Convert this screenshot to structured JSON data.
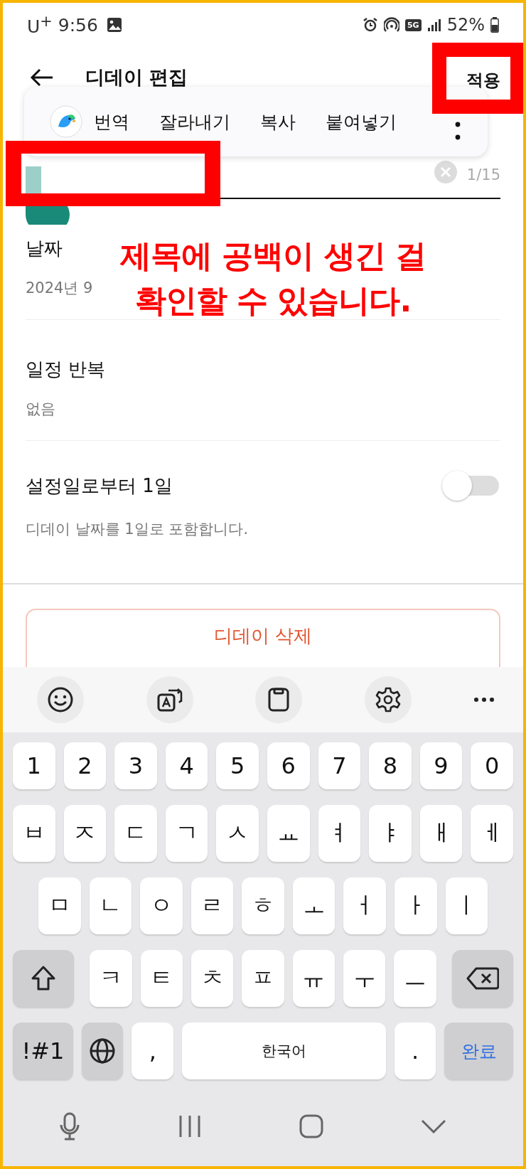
{
  "status_bar": {
    "carrier": "U$^{+}$",
    "time": "9:56",
    "network": "5G",
    "battery": "52%"
  },
  "header": {
    "title": "디데이 편집",
    "action": "적용"
  },
  "text_menu": {
    "items": [
      "번역",
      "잘라내기",
      "복사",
      "붙여넣기"
    ]
  },
  "title_field": {
    "counter": "1/15"
  },
  "sections": [
    {
      "kind": "value",
      "label": "날짜",
      "value": "2024년 9"
    },
    {
      "kind": "value",
      "label": "일정 반복",
      "value": "없음"
    },
    {
      "kind": "toggle",
      "label": "설정일로부터 1일",
      "description": "디데이 날짜를 1일로 포함합니다.",
      "on": false
    }
  ],
  "delete_button": "디데이 삭제",
  "keyboard": {
    "rows": [
      {
        "keys": [
          {
            "kind": "char",
            "label": "1"
          },
          {
            "kind": "char",
            "label": "2"
          },
          {
            "kind": "char",
            "label": "3"
          },
          {
            "kind": "char",
            "label": "4"
          },
          {
            "kind": "char",
            "label": "5"
          },
          {
            "kind": "char",
            "label": "6"
          },
          {
            "kind": "char",
            "label": "7"
          },
          {
            "kind": "char",
            "label": "8"
          },
          {
            "kind": "char",
            "label": "9"
          },
          {
            "kind": "char",
            "label": "0"
          }
        ]
      },
      {
        "keys": [
          {
            "kind": "char",
            "label": "ㅂ"
          },
          {
            "kind": "char",
            "label": "ㅈ"
          },
          {
            "kind": "char",
            "label": "ㄷ"
          },
          {
            "kind": "char",
            "label": "ㄱ"
          },
          {
            "kind": "char",
            "label": "ㅅ"
          },
          {
            "kind": "char",
            "label": "ㅛ"
          },
          {
            "kind": "char",
            "label": "ㅕ"
          },
          {
            "kind": "char",
            "label": "ㅑ"
          },
          {
            "kind": "char",
            "label": "ㅐ"
          },
          {
            "kind": "char",
            "label": "ㅔ"
          }
        ]
      },
      {
        "keys": [
          {
            "kind": "char",
            "label": "ㅁ"
          },
          {
            "kind": "char",
            "label": "ㄴ"
          },
          {
            "kind": "char",
            "label": "ㅇ"
          },
          {
            "kind": "char",
            "label": "ㄹ"
          },
          {
            "kind": "char",
            "label": "ㅎ"
          },
          {
            "kind": "char",
            "label": "ㅗ"
          },
          {
            "kind": "char",
            "label": "ㅓ"
          },
          {
            "kind": "char",
            "label": "ㅏ"
          },
          {
            "kind": "char",
            "label": "ㅣ"
          }
        ]
      },
      {
        "keys": [
          {
            "kind": "shift"
          },
          {
            "kind": "char",
            "label": "ㅋ"
          },
          {
            "kind": "char",
            "label": "ㅌ"
          },
          {
            "kind": "char",
            "label": "ㅊ"
          },
          {
            "kind": "char",
            "label": "ㅍ"
          },
          {
            "kind": "char",
            "label": "ㅠ"
          },
          {
            "kind": "char",
            "label": "ㅜ"
          },
          {
            "kind": "char",
            "label": "ㅡ"
          },
          {
            "kind": "backspace"
          }
        ]
      },
      {
        "keys": [
          {
            "kind": "symbols",
            "label": "!#1"
          },
          {
            "kind": "globe"
          },
          {
            "kind": "char",
            "label": ","
          },
          {
            "kind": "space",
            "label": "한국어"
          },
          {
            "kind": "char",
            "label": "."
          },
          {
            "kind": "done",
            "label": "완료"
          }
        ]
      }
    ]
  },
  "annotation": {
    "lines": [
      "제목에 공백이 생긴 걸",
      "확인할 수 있습니다."
    ]
  }
}
